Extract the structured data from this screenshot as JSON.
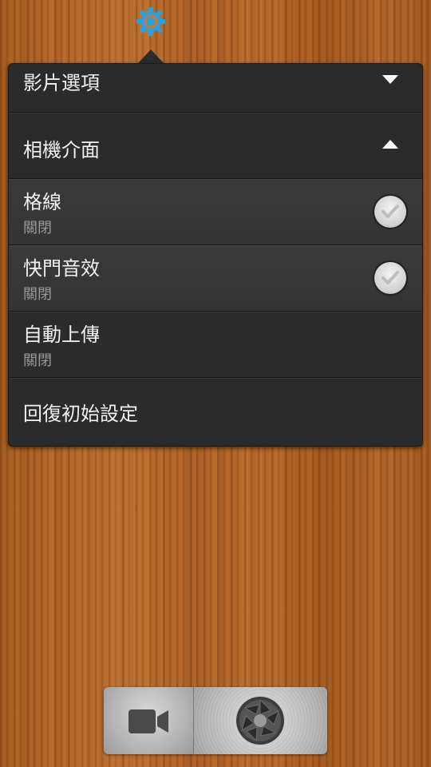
{
  "settings_icon": "gear-icon",
  "menu": {
    "video_options": {
      "label": "影片選項",
      "icon": "triangle-down-icon"
    },
    "camera_interface": {
      "label": "相機介面",
      "icon": "triangle-up-icon"
    },
    "items": [
      {
        "label": "格線",
        "value": "關閉",
        "has_check": true
      },
      {
        "label": "快門音效",
        "value": "關閉",
        "has_check": true
      },
      {
        "label": "自動上傳",
        "value": "關閉",
        "has_check": false
      }
    ],
    "reset": {
      "label": "回復初始設定"
    }
  },
  "dock": {
    "video_icon": "video-camera-icon",
    "shutter_icon": "aperture-icon"
  },
  "colors": {
    "accent": "#2e9fd8",
    "popup_bg": "#2b2b2b",
    "text": "#f2f2f2",
    "subtext": "#9a9a9a"
  }
}
